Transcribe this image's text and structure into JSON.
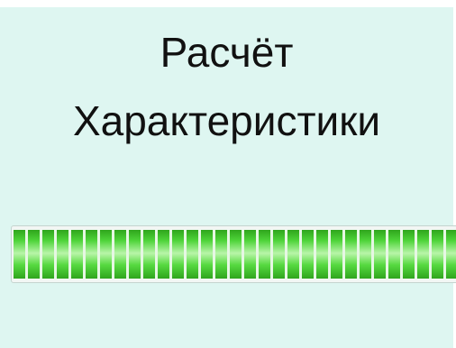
{
  "status": {
    "line1": "Расчёт",
    "line2": "Характеристики"
  },
  "progress": {
    "fraction": 1.0
  },
  "colors": {
    "background": "#def6f1",
    "progress_fill": "#4fd43a",
    "text": "#111111"
  }
}
